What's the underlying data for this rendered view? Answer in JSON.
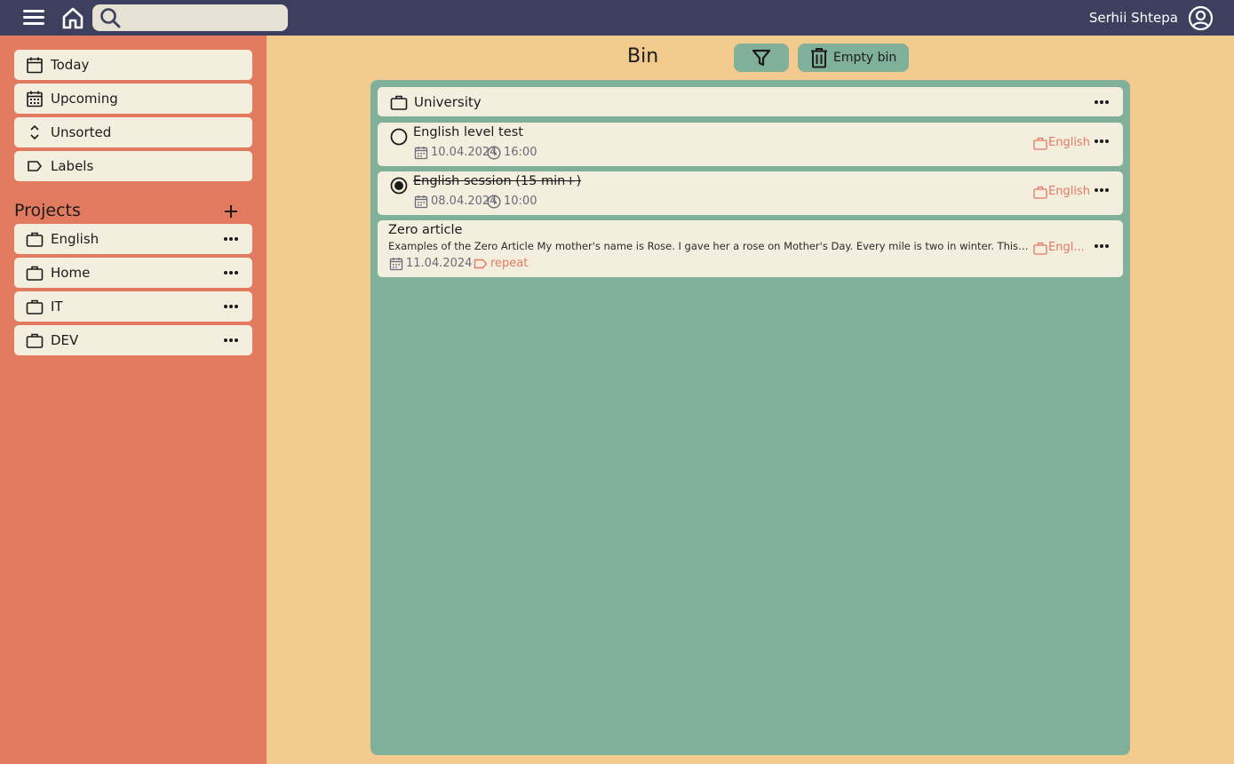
{
  "header": {
    "search": {
      "placeholder": "",
      "value": ""
    },
    "user_name": "Serhii Shtepa"
  },
  "sidebar": {
    "nav": [
      {
        "label": "Today",
        "icon": "calendar-icon"
      },
      {
        "label": "Upcoming",
        "icon": "calendar-grid-icon"
      },
      {
        "label": "Unsorted",
        "icon": "sort-icon"
      },
      {
        "label": "Labels",
        "icon": "label-icon"
      }
    ],
    "projects_title": "Projects",
    "projects": [
      {
        "label": "English",
        "icon": "briefcase-icon"
      },
      {
        "label": "Home",
        "icon": "briefcase-icon"
      },
      {
        "label": "IT",
        "icon": "briefcase-icon"
      },
      {
        "label": "DEV",
        "icon": "briefcase-icon"
      }
    ]
  },
  "main": {
    "title": "Bin",
    "empty_bin_label": "Empty bin",
    "section": {
      "label": "University",
      "icon": "briefcase-icon"
    },
    "tasks": [
      {
        "title": "English level test",
        "date": "10.04.2024",
        "time": "16:00",
        "project": "English",
        "done": false
      },
      {
        "title": "English session (15 min+)",
        "date": "08.04.2024",
        "time": "10:00",
        "project": "English",
        "done": true
      },
      {
        "title": "Zero article",
        "description": "Examples of the Zero Article My mother's name is Rose. I gave her a rose on Mother's Day. Every mile is two in winter. This pla...",
        "date": "11.04.2024",
        "label": "repeat",
        "project": "Engl...",
        "done": false
      }
    ]
  },
  "colors": {
    "topbar": "#3c3f5e",
    "sidebar": "#e27a60",
    "background": "#f2ca8e",
    "panel": "#80b09a",
    "card": "#f4eedf",
    "accent": "#e27a60"
  }
}
